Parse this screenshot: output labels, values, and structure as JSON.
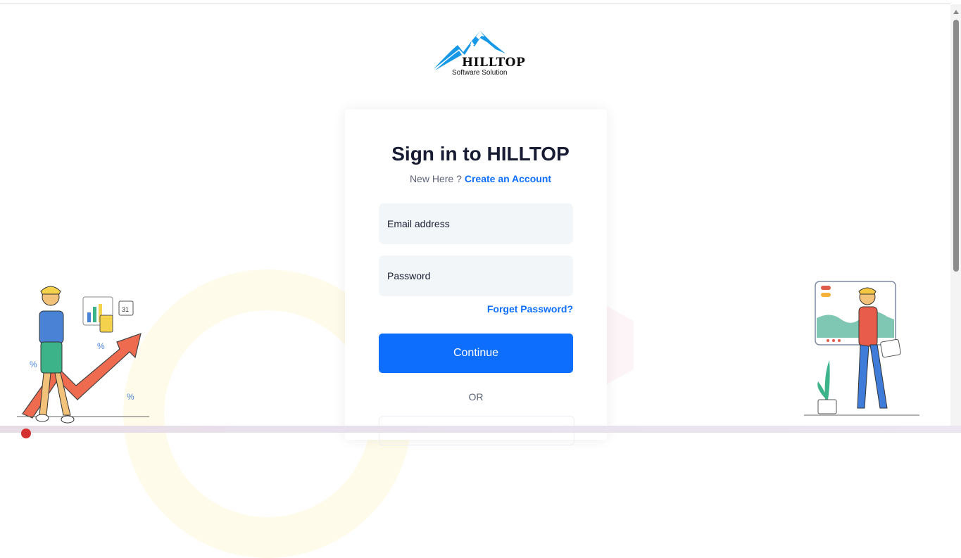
{
  "brand": {
    "name": "HILLTOP",
    "tagline": "Software Solution",
    "mountain_color": "#1798e6"
  },
  "signin": {
    "title": "Sign in to HILLTOP",
    "new_here": "New Here ?",
    "create_account": "Create an Account",
    "email_placeholder": "Email address",
    "password_placeholder": "Password",
    "forgot_password": "Forget Password?",
    "continue_label": "Continue",
    "or_label": "OR"
  },
  "decor": {
    "left_illustration": "growth-chart-person-illustration",
    "right_illustration": "dashboard-person-illustration",
    "percent_symbol": "%",
    "calendar_day": "31"
  },
  "colors": {
    "primary": "#0d6efd",
    "heading": "#181c32",
    "muted": "#5e6278",
    "input_bg": "#f3f6f9"
  }
}
